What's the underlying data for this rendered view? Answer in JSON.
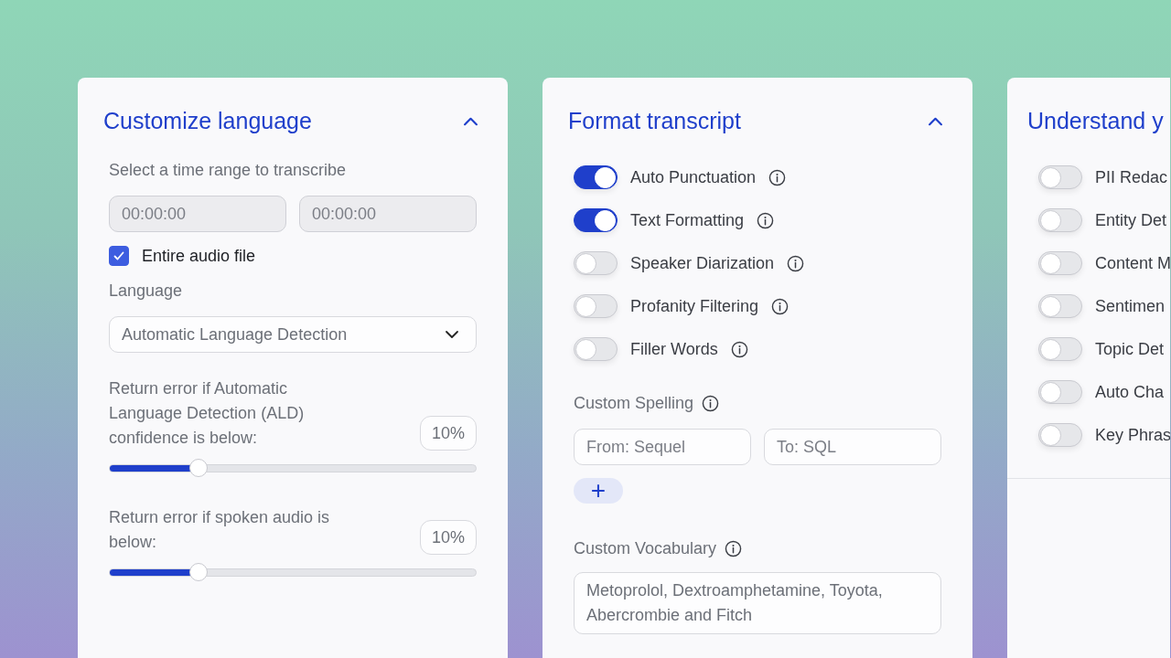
{
  "panels": [
    {
      "kind": "language",
      "title": "Customize language",
      "expanded": true,
      "time_range": {
        "label": "Select a time range to transcribe",
        "start": {
          "placeholder": "00:00:00",
          "disabled": true
        },
        "end": {
          "placeholder": "00:00:00",
          "disabled": true
        }
      },
      "entire_file": {
        "label": "Entire audio file",
        "checked": true
      },
      "language": {
        "label": "Language",
        "value": "Automatic Language Detection"
      },
      "thresholds": [
        {
          "label": "Return error if Automatic Language Detection (ALD) confidence is below:",
          "value": "10%",
          "level": 0.245
        },
        {
          "label": "Return error if spoken audio is below:",
          "value": "10%",
          "level": 0.245
        }
      ]
    },
    {
      "kind": "format",
      "title": "Format transcript",
      "expanded": true,
      "toggles": [
        {
          "label": "Auto Punctuation",
          "on": true
        },
        {
          "label": "Text Formatting",
          "on": true
        },
        {
          "label": "Speaker Diarization",
          "on": false
        },
        {
          "label": "Profanity Filtering",
          "on": false
        },
        {
          "label": "Filler Words",
          "on": false
        }
      ],
      "custom_spelling": {
        "label": "Custom Spelling",
        "from": {
          "placeholder": "From: Sequel"
        },
        "to": {
          "placeholder": "To: SQL"
        },
        "add_button": "+"
      },
      "vocabulary": {
        "label": "Custom Vocabulary",
        "placeholder": "Metoprolol, Dextroamphetamine, Toyota, Abercrombie and Fitch"
      }
    },
    {
      "kind": "understand",
      "title": "Understand y",
      "toggles": [
        {
          "label": "PII Redac",
          "on": false
        },
        {
          "label": "Entity Det",
          "on": false
        },
        {
          "label": "Content M",
          "on": false
        },
        {
          "label": "Sentimen",
          "on": false
        },
        {
          "label": "Topic Det",
          "on": false
        },
        {
          "label": "Auto Cha",
          "on": false
        },
        {
          "label": "Key Phras",
          "on": false
        }
      ]
    }
  ]
}
